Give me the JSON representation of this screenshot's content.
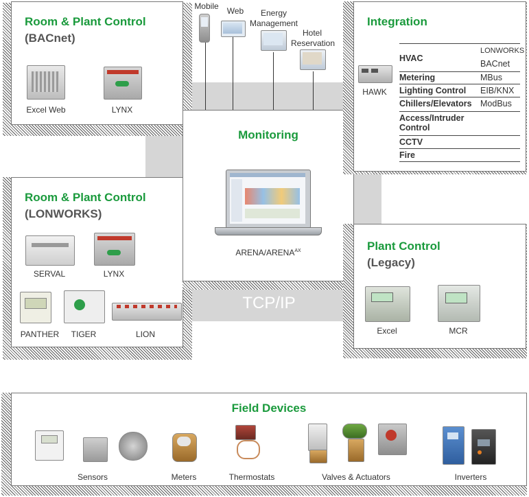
{
  "top_devices": {
    "mobile": "Mobile",
    "web": "Web",
    "energy_line1": "Energy",
    "energy_line2": "Management",
    "hotel_line1": "Hotel",
    "hotel_line2": "Reservation"
  },
  "bacnet": {
    "title": "Room & Plant Control",
    "subtitle": "(BACnet)",
    "devices": [
      "Excel Web",
      "LYNX"
    ]
  },
  "lonworks": {
    "title": "Room & Plant Control",
    "subtitle": "(LONWORKS)",
    "devices": [
      "SERVAL",
      "LYNX",
      "PANTHER",
      "TIGER",
      "LION"
    ]
  },
  "monitoring": {
    "title": "Monitoring",
    "device": "ARENA/ARENA",
    "device_sup": "AX"
  },
  "integration": {
    "title": "Integration",
    "hawk": "HAWK",
    "rows": [
      {
        "name": "HVAC",
        "values": [
          "LONWORKS",
          "BACnet"
        ]
      },
      {
        "name": "Metering",
        "values": [
          "MBus"
        ]
      },
      {
        "name": "Lighting Control",
        "values": [
          "EIB/KNX"
        ]
      },
      {
        "name": "Chillers/Elevators",
        "values": [
          "ModBus"
        ]
      },
      {
        "name": "Access/Intruder Control",
        "values": []
      },
      {
        "name": "CCTV",
        "values": []
      },
      {
        "name": "Fire",
        "values": []
      }
    ]
  },
  "plant_legacy": {
    "title": "Plant Control",
    "subtitle": "(Legacy)",
    "devices": [
      "Excel",
      "MCR"
    ]
  },
  "network": "TCP/IP",
  "field": {
    "title": "Field Devices",
    "groups": [
      "Sensors",
      "Meters",
      "Thermostats",
      "Valves & Actuators",
      "Inverters"
    ]
  },
  "colors": {
    "accent_green": "#1a9a3c",
    "bus_gray": "#d6d6d6"
  }
}
